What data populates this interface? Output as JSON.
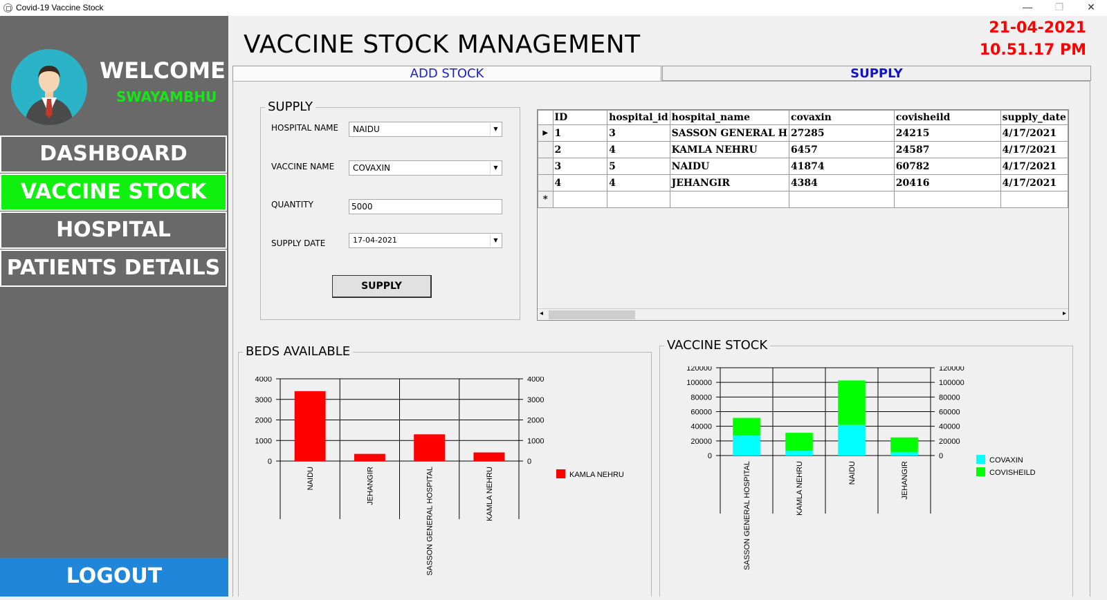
{
  "window": {
    "title": "Covid-19 Vaccine Stock",
    "minimize": "—",
    "maximize": "❐",
    "close": "✕"
  },
  "sidebar": {
    "welcome": "WELCOME",
    "username": "SWAYAMBHU",
    "nav": [
      {
        "label": "DASHBOARD",
        "active": false
      },
      {
        "label": "VACCINE STOCK",
        "active": true
      },
      {
        "label": "HOSPITAL",
        "active": false
      },
      {
        "label": "PATIENTS DETAILS",
        "active": false
      }
    ],
    "logout": "LOGOUT"
  },
  "header": {
    "title": "VACCINE STOCK MANAGEMENT",
    "date": "21-04-2021",
    "time": "10.51.17 PM"
  },
  "tabs": [
    {
      "label": "ADD STOCK",
      "active": false
    },
    {
      "label": "SUPPLY",
      "active": true
    }
  ],
  "supply_form": {
    "group_title": "SUPPLY",
    "hospital_label": "HOSPITAL NAME",
    "hospital_value": "NAIDU",
    "vaccine_label": "VACCINE NAME",
    "vaccine_value": "COVAXIN",
    "quantity_label": "QUANTITY",
    "quantity_value": "5000",
    "date_label": "SUPPLY DATE",
    "date_value": "17-04-2021",
    "button": "SUPPLY"
  },
  "grid": {
    "columns": [
      "ID",
      "hospital_id",
      "hospital_name",
      "covaxin",
      "covisheild",
      "supply_date"
    ],
    "rows": [
      [
        "1",
        "3",
        "SASSON GENERAL H",
        "27285",
        "24215",
        "4/17/2021"
      ],
      [
        "2",
        "4",
        "KAMLA NEHRU",
        "6457",
        "24587",
        "4/17/2021"
      ],
      [
        "3",
        "5",
        "NAIDU",
        "41874",
        "60782",
        "4/17/2021"
      ],
      [
        "4",
        "4",
        "JEHANGIR",
        "4384",
        "20416",
        "4/17/2021"
      ]
    ],
    "current_row_marker": "▶",
    "new_row_marker": "*"
  },
  "chart_data": [
    {
      "type": "bar",
      "title": "BEDS AVAILABLE",
      "categories": [
        "NAIDU",
        "JEHANGIR",
        "SASSON GENERAL HOSPITAL",
        "KAMLA NEHRU"
      ],
      "series": [
        {
          "name": "KAMLA NEHRU",
          "values": [
            3400,
            350,
            1300,
            420
          ],
          "color": "#ff0000"
        }
      ],
      "yticks": [
        "0",
        "1000",
        "2000",
        "3000",
        "4000"
      ],
      "ylim": [
        0,
        4000
      ],
      "legend": "right"
    },
    {
      "type": "bar",
      "stacked": true,
      "title": "VACCINE STOCK",
      "categories": [
        "SASSON GENERAL HOSPITAL",
        "KAMLA NEHRU",
        "NAIDU",
        "JEHANGIR"
      ],
      "series": [
        {
          "name": "COVAXIN",
          "values": [
            27285,
            6457,
            41874,
            4384
          ],
          "color": "#00ffff"
        },
        {
          "name": "COVISHEILD",
          "values": [
            24215,
            24587,
            60782,
            20416
          ],
          "color": "#00ff00"
        }
      ],
      "yticks": [
        "0",
        "20000",
        "40000",
        "60000",
        "80000",
        "100000",
        "120000"
      ],
      "ylim": [
        0,
        120000
      ],
      "legend": "right"
    }
  ]
}
